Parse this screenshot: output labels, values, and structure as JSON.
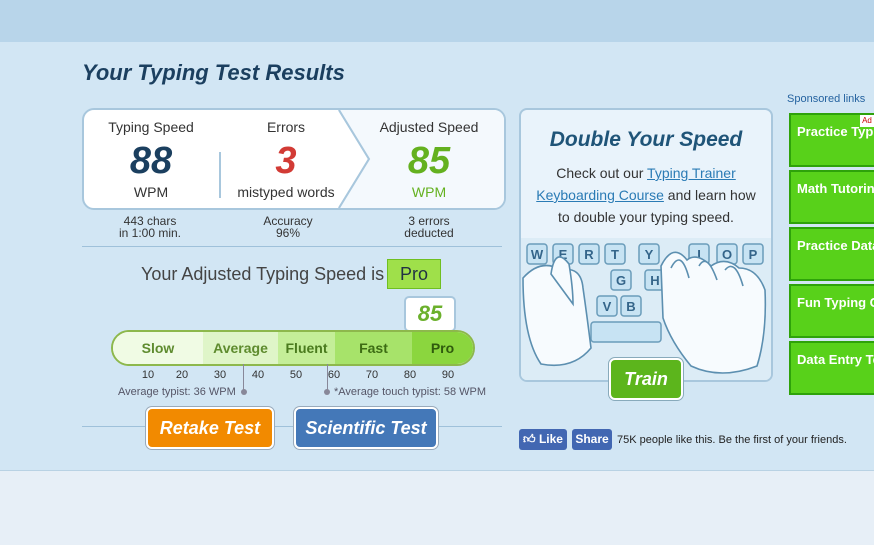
{
  "title": "Your Typing Test Results",
  "results": {
    "speed": {
      "label": "Typing Speed",
      "value": "88",
      "unit": "WPM",
      "detail_line1": "443 chars",
      "detail_line2": "in 1:00 min."
    },
    "errors": {
      "label": "Errors",
      "value": "3",
      "unit": "mistyped words",
      "detail_line1": "Accuracy",
      "detail_line2": "96%"
    },
    "adjusted": {
      "label": "Adjusted Speed",
      "value": "85",
      "unit": "WPM",
      "detail_line1": "3 errors",
      "detail_line2": "deducted"
    }
  },
  "adjusted_label": "Your Adjusted Typing Speed is",
  "adjusted_level": "Pro",
  "pointer_value": "85",
  "speed_levels": [
    "Slow",
    "Average",
    "Fluent",
    "Fast",
    "Pro"
  ],
  "ticks": [
    "10",
    "20",
    "30",
    "40",
    "50",
    "60",
    "70",
    "80",
    "90"
  ],
  "notes": {
    "average": "Average typist: 36 WPM",
    "touch": "*Average touch typist: 58 WPM"
  },
  "buttons": {
    "retake": "Retake Test",
    "scientific": "Scientific Test"
  },
  "promo": {
    "heading": "Double Your Speed",
    "text_before": "Check out our",
    "link1": "Typing Trainer",
    "link2": "Keyboarding Course",
    "text_after": "and learn how to double your typing speed.",
    "train_label": "Train"
  },
  "facebook": {
    "like": "Like",
    "share": "Share",
    "text": "75K people like this. Be the first of your friends."
  },
  "ads": {
    "header": "Sponsored links",
    "choices_mark": "Ad",
    "items": [
      "Practice Typing Test",
      "Math Tutoring Websites",
      "Practice Data",
      "Fun Typing Games",
      "Data Entry Test"
    ]
  },
  "colors": {
    "speed": "#1b3f5f",
    "errors": "#d23b35",
    "adjusted": "#64b11f",
    "retake": "#f28a00",
    "scientific": "#4478b8"
  }
}
